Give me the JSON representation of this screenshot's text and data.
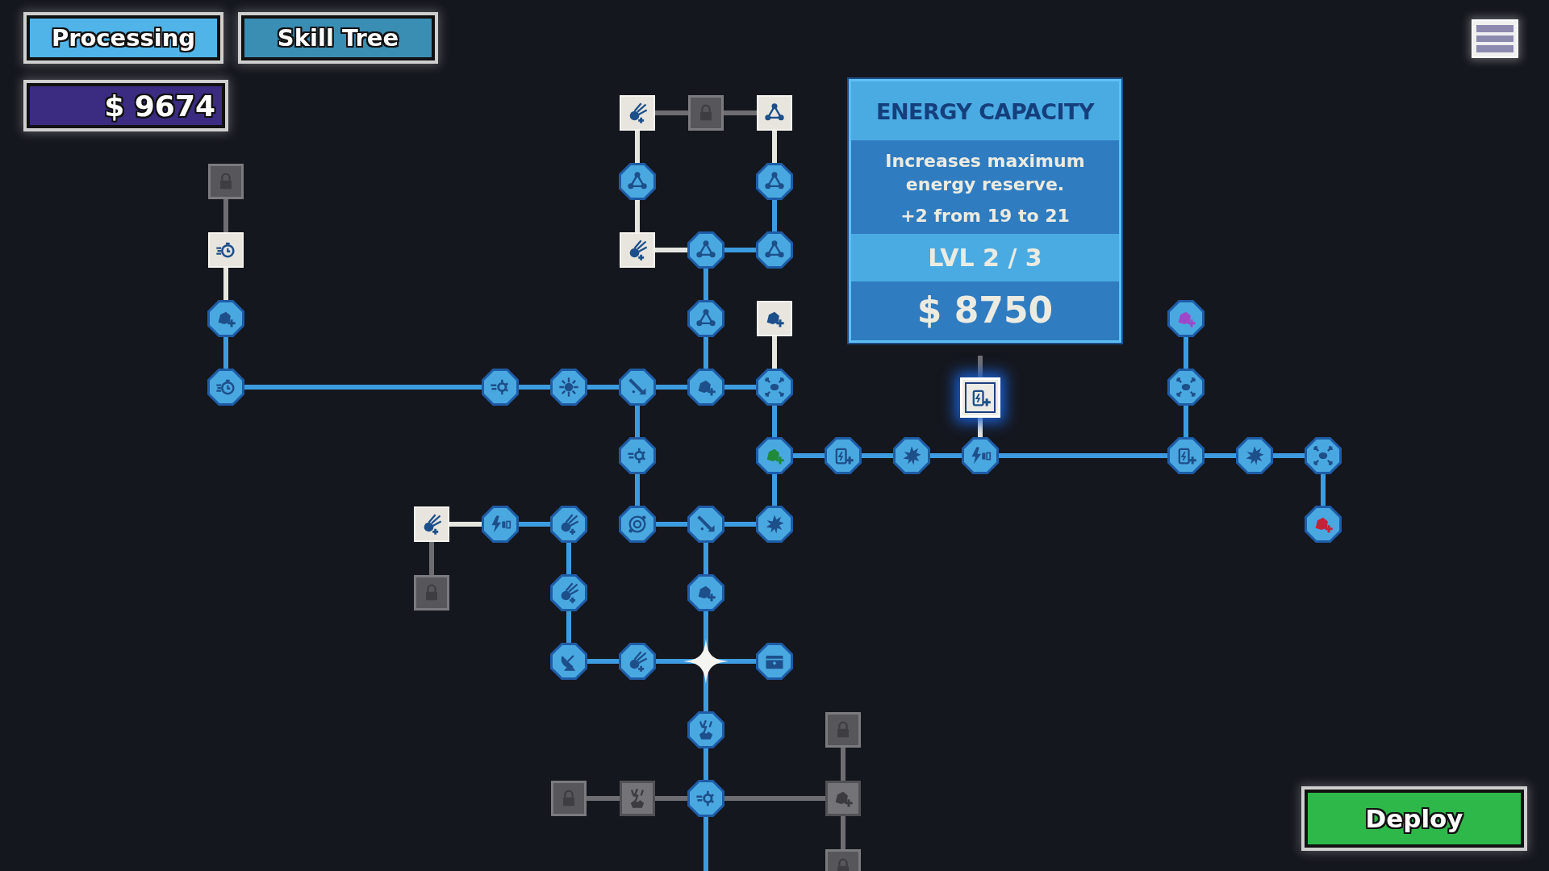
{
  "tabs": [
    {
      "label": "Processing",
      "selected": false
    },
    {
      "label": "Skill Tree",
      "selected": true
    }
  ],
  "balance": "$ 9674",
  "tooltip": {
    "title": "ENERGY CAPACITY",
    "description": "Increases maximum energy reserve.",
    "effect": "+2 from 19 to 21",
    "level": "LVL 2 / 3",
    "price": "$ 8750"
  },
  "skill_tree": {
    "nodes": [
      {
        "kind": "available",
        "selected": false
      },
      {
        "kind": "locked",
        "selected": false
      },
      {
        "kind": "available",
        "selected": false
      },
      {
        "kind": "locked",
        "selected": false
      },
      {
        "kind": "owned",
        "selected": false
      },
      {
        "kind": "owned",
        "selected": false
      },
      {
        "kind": "available",
        "selected": false
      },
      {
        "kind": "available",
        "selected": false
      },
      {
        "kind": "owned",
        "selected": false
      },
      {
        "kind": "owned",
        "selected": false
      },
      {
        "kind": "owned",
        "selected": false
      },
      {
        "kind": "owned",
        "selected": false
      },
      {
        "kind": "available",
        "selected": false
      },
      {
        "kind": "owned",
        "selected": false
      },
      {
        "kind": "owned",
        "selected": false
      },
      {
        "kind": "owned",
        "selected": false
      },
      {
        "kind": "owned",
        "selected": false
      },
      {
        "kind": "owned",
        "selected": false
      },
      {
        "kind": "owned",
        "selected": false
      },
      {
        "kind": "owned",
        "selected": false
      },
      {
        "kind": "available",
        "selected": true
      },
      {
        "kind": "owned",
        "selected": false
      },
      {
        "kind": "owned",
        "selected": false
      },
      {
        "kind": "owned",
        "selected": false
      },
      {
        "kind": "owned",
        "selected": false
      },
      {
        "kind": "owned",
        "selected": false
      },
      {
        "kind": "owned",
        "selected": false
      },
      {
        "kind": "owned",
        "selected": false
      },
      {
        "kind": "owned",
        "selected": false
      },
      {
        "kind": "owned",
        "selected": false
      },
      {
        "kind": "available",
        "selected": false
      },
      {
        "kind": "owned",
        "selected": false
      },
      {
        "kind": "owned",
        "selected": false
      },
      {
        "kind": "owned",
        "selected": false
      },
      {
        "kind": "owned",
        "selected": false
      },
      {
        "kind": "owned",
        "selected": false
      },
      {
        "kind": "owned",
        "selected": false
      },
      {
        "kind": "locked",
        "selected": false
      },
      {
        "kind": "owned",
        "selected": false
      },
      {
        "kind": "owned",
        "selected": false
      },
      {
        "kind": "owned",
        "selected": false
      },
      {
        "kind": "owned",
        "selected": false
      },
      {
        "kind": "start",
        "selected": false
      },
      {
        "kind": "owned",
        "selected": false
      },
      {
        "kind": "owned",
        "selected": false
      },
      {
        "kind": "locked",
        "selected": false
      },
      {
        "kind": "locked",
        "selected": false
      },
      {
        "kind": "preview",
        "selected": false
      },
      {
        "kind": "owned",
        "selected": false
      },
      {
        "kind": "preview",
        "selected": false
      },
      {
        "kind": "locked",
        "selected": false
      }
    ]
  },
  "deploy_button": "Deploy"
}
